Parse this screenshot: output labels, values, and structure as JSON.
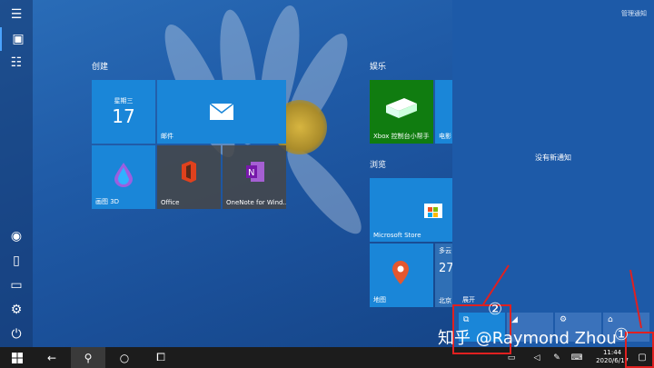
{
  "start": {
    "groups": {
      "create": "创建",
      "entertainment": "娱乐",
      "browse": "浏览"
    },
    "tiles": {
      "calendar_day": "星期三",
      "calendar_date": "17",
      "mail": "邮件",
      "paint3d": "画图 3D",
      "office": "Office",
      "onenote": "OneNote for Wind...",
      "xbox": "Xbox 控制台小帮手",
      "movies": "电影",
      "store": "Microsoft Store",
      "maps": "地图",
      "weather_top": "多云",
      "weather_temp": "27",
      "weather_city": "北京"
    }
  },
  "action_center": {
    "manage": "管理通知",
    "no_notifications": "没有新通知",
    "collapse": "展开"
  },
  "taskbar": {
    "time": "11:44",
    "date": "2020/6/17"
  },
  "annotations": {
    "one": "①",
    "two": "②",
    "watermark": "知乎 @Raymond Zhou"
  }
}
